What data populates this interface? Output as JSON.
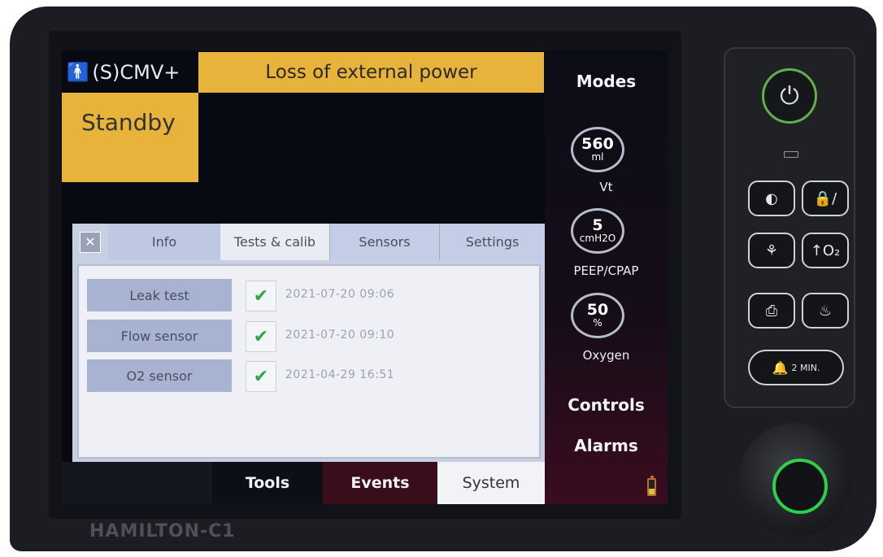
{
  "device": {
    "brand": "HAMILTON-C1"
  },
  "header": {
    "mode": "(S)CMV+",
    "alarm_message": "Loss of external power",
    "status": "Standby"
  },
  "right_panel": {
    "modes_label": "Modes",
    "parameters": [
      {
        "value": "560",
        "unit": "ml",
        "label": "Vt"
      },
      {
        "value": "5",
        "unit": "cmH2O",
        "label": "PEEP/CPAP"
      },
      {
        "value": "50",
        "unit": "%",
        "label": "Oxygen"
      }
    ],
    "controls_label": "Controls",
    "alarms_label": "Alarms"
  },
  "system_panel": {
    "close_icon": "x-icon",
    "tabs": [
      {
        "label": "Info"
      },
      {
        "label": "Tests & calib"
      },
      {
        "label": "Sensors"
      },
      {
        "label": "Settings"
      }
    ],
    "active_tab": "Tests & calib",
    "tests": [
      {
        "name": "Leak test",
        "status": "passed",
        "timestamp": "2021-07-20 09:06"
      },
      {
        "name": "Flow sensor",
        "status": "passed",
        "timestamp": "2021-07-20 09:10"
      },
      {
        "name": "O2 sensor",
        "status": "passed",
        "timestamp": "2021-04-29 16:51"
      }
    ]
  },
  "bottom_tabs": [
    {
      "label": "Tools"
    },
    {
      "label": "Events"
    },
    {
      "label": "System"
    }
  ],
  "hardware_keys": {
    "oxygen_key": "↑O₂",
    "alarm_silence_key": "2 MIN."
  },
  "colors": {
    "alarm_yellow": "#e8b33a",
    "check_green": "#2fa743",
    "power_green": "#5fb14b",
    "events_maroon": "#3a0d1a"
  }
}
